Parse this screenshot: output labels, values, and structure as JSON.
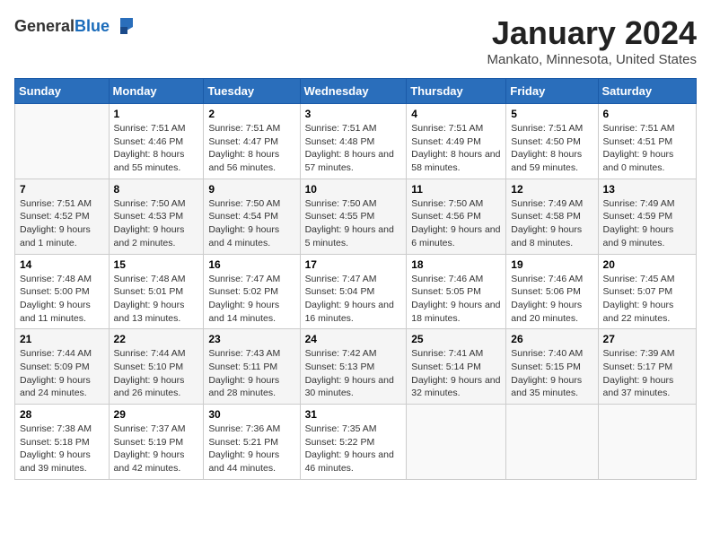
{
  "logo": {
    "general": "General",
    "blue": "Blue"
  },
  "header": {
    "title": "January 2024",
    "subtitle": "Mankato, Minnesota, United States"
  },
  "weekdays": [
    "Sunday",
    "Monday",
    "Tuesday",
    "Wednesday",
    "Thursday",
    "Friday",
    "Saturday"
  ],
  "weeks": [
    [
      {
        "day": "",
        "sunrise": "",
        "sunset": "",
        "daylight": ""
      },
      {
        "day": "1",
        "sunrise": "Sunrise: 7:51 AM",
        "sunset": "Sunset: 4:46 PM",
        "daylight": "Daylight: 8 hours and 55 minutes."
      },
      {
        "day": "2",
        "sunrise": "Sunrise: 7:51 AM",
        "sunset": "Sunset: 4:47 PM",
        "daylight": "Daylight: 8 hours and 56 minutes."
      },
      {
        "day": "3",
        "sunrise": "Sunrise: 7:51 AM",
        "sunset": "Sunset: 4:48 PM",
        "daylight": "Daylight: 8 hours and 57 minutes."
      },
      {
        "day": "4",
        "sunrise": "Sunrise: 7:51 AM",
        "sunset": "Sunset: 4:49 PM",
        "daylight": "Daylight: 8 hours and 58 minutes."
      },
      {
        "day": "5",
        "sunrise": "Sunrise: 7:51 AM",
        "sunset": "Sunset: 4:50 PM",
        "daylight": "Daylight: 8 hours and 59 minutes."
      },
      {
        "day": "6",
        "sunrise": "Sunrise: 7:51 AM",
        "sunset": "Sunset: 4:51 PM",
        "daylight": "Daylight: 9 hours and 0 minutes."
      }
    ],
    [
      {
        "day": "7",
        "sunrise": "Sunrise: 7:51 AM",
        "sunset": "Sunset: 4:52 PM",
        "daylight": "Daylight: 9 hours and 1 minute."
      },
      {
        "day": "8",
        "sunrise": "Sunrise: 7:50 AM",
        "sunset": "Sunset: 4:53 PM",
        "daylight": "Daylight: 9 hours and 2 minutes."
      },
      {
        "day": "9",
        "sunrise": "Sunrise: 7:50 AM",
        "sunset": "Sunset: 4:54 PM",
        "daylight": "Daylight: 9 hours and 4 minutes."
      },
      {
        "day": "10",
        "sunrise": "Sunrise: 7:50 AM",
        "sunset": "Sunset: 4:55 PM",
        "daylight": "Daylight: 9 hours and 5 minutes."
      },
      {
        "day": "11",
        "sunrise": "Sunrise: 7:50 AM",
        "sunset": "Sunset: 4:56 PM",
        "daylight": "Daylight: 9 hours and 6 minutes."
      },
      {
        "day": "12",
        "sunrise": "Sunrise: 7:49 AM",
        "sunset": "Sunset: 4:58 PM",
        "daylight": "Daylight: 9 hours and 8 minutes."
      },
      {
        "day": "13",
        "sunrise": "Sunrise: 7:49 AM",
        "sunset": "Sunset: 4:59 PM",
        "daylight": "Daylight: 9 hours and 9 minutes."
      }
    ],
    [
      {
        "day": "14",
        "sunrise": "Sunrise: 7:48 AM",
        "sunset": "Sunset: 5:00 PM",
        "daylight": "Daylight: 9 hours and 11 minutes."
      },
      {
        "day": "15",
        "sunrise": "Sunrise: 7:48 AM",
        "sunset": "Sunset: 5:01 PM",
        "daylight": "Daylight: 9 hours and 13 minutes."
      },
      {
        "day": "16",
        "sunrise": "Sunrise: 7:47 AM",
        "sunset": "Sunset: 5:02 PM",
        "daylight": "Daylight: 9 hours and 14 minutes."
      },
      {
        "day": "17",
        "sunrise": "Sunrise: 7:47 AM",
        "sunset": "Sunset: 5:04 PM",
        "daylight": "Daylight: 9 hours and 16 minutes."
      },
      {
        "day": "18",
        "sunrise": "Sunrise: 7:46 AM",
        "sunset": "Sunset: 5:05 PM",
        "daylight": "Daylight: 9 hours and 18 minutes."
      },
      {
        "day": "19",
        "sunrise": "Sunrise: 7:46 AM",
        "sunset": "Sunset: 5:06 PM",
        "daylight": "Daylight: 9 hours and 20 minutes."
      },
      {
        "day": "20",
        "sunrise": "Sunrise: 7:45 AM",
        "sunset": "Sunset: 5:07 PM",
        "daylight": "Daylight: 9 hours and 22 minutes."
      }
    ],
    [
      {
        "day": "21",
        "sunrise": "Sunrise: 7:44 AM",
        "sunset": "Sunset: 5:09 PM",
        "daylight": "Daylight: 9 hours and 24 minutes."
      },
      {
        "day": "22",
        "sunrise": "Sunrise: 7:44 AM",
        "sunset": "Sunset: 5:10 PM",
        "daylight": "Daylight: 9 hours and 26 minutes."
      },
      {
        "day": "23",
        "sunrise": "Sunrise: 7:43 AM",
        "sunset": "Sunset: 5:11 PM",
        "daylight": "Daylight: 9 hours and 28 minutes."
      },
      {
        "day": "24",
        "sunrise": "Sunrise: 7:42 AM",
        "sunset": "Sunset: 5:13 PM",
        "daylight": "Daylight: 9 hours and 30 minutes."
      },
      {
        "day": "25",
        "sunrise": "Sunrise: 7:41 AM",
        "sunset": "Sunset: 5:14 PM",
        "daylight": "Daylight: 9 hours and 32 minutes."
      },
      {
        "day": "26",
        "sunrise": "Sunrise: 7:40 AM",
        "sunset": "Sunset: 5:15 PM",
        "daylight": "Daylight: 9 hours and 35 minutes."
      },
      {
        "day": "27",
        "sunrise": "Sunrise: 7:39 AM",
        "sunset": "Sunset: 5:17 PM",
        "daylight": "Daylight: 9 hours and 37 minutes."
      }
    ],
    [
      {
        "day": "28",
        "sunrise": "Sunrise: 7:38 AM",
        "sunset": "Sunset: 5:18 PM",
        "daylight": "Daylight: 9 hours and 39 minutes."
      },
      {
        "day": "29",
        "sunrise": "Sunrise: 7:37 AM",
        "sunset": "Sunset: 5:19 PM",
        "daylight": "Daylight: 9 hours and 42 minutes."
      },
      {
        "day": "30",
        "sunrise": "Sunrise: 7:36 AM",
        "sunset": "Sunset: 5:21 PM",
        "daylight": "Daylight: 9 hours and 44 minutes."
      },
      {
        "day": "31",
        "sunrise": "Sunrise: 7:35 AM",
        "sunset": "Sunset: 5:22 PM",
        "daylight": "Daylight: 9 hours and 46 minutes."
      },
      {
        "day": "",
        "sunrise": "",
        "sunset": "",
        "daylight": ""
      },
      {
        "day": "",
        "sunrise": "",
        "sunset": "",
        "daylight": ""
      },
      {
        "day": "",
        "sunrise": "",
        "sunset": "",
        "daylight": ""
      }
    ]
  ]
}
